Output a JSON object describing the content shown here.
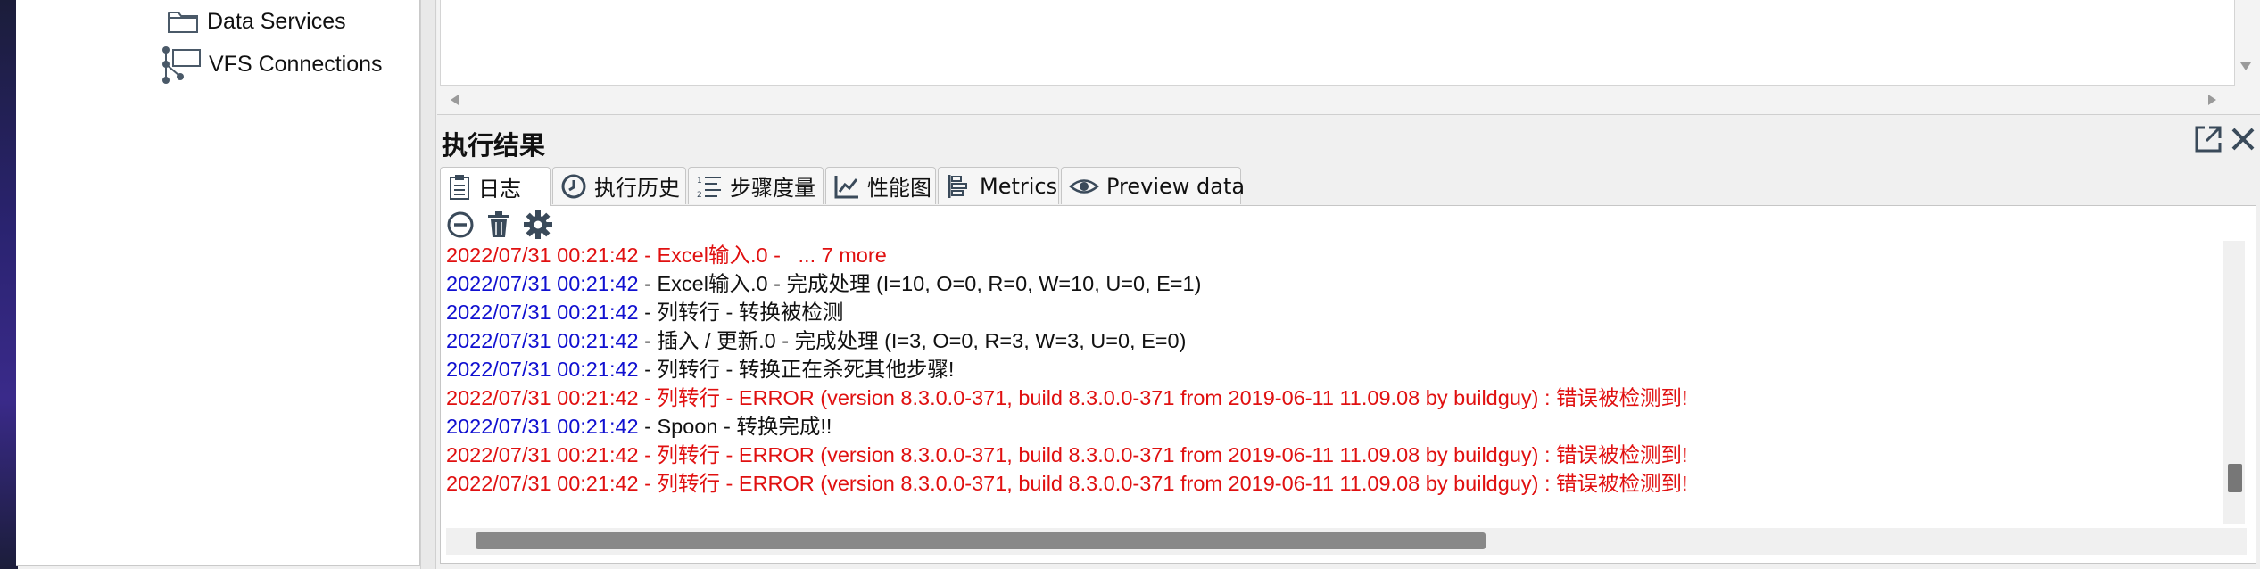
{
  "tree": {
    "items": [
      {
        "label": "Data Services",
        "icon": "folder-icon"
      },
      {
        "label": "VFS Connections",
        "icon": "network-icon"
      }
    ]
  },
  "results": {
    "title": "执行结果"
  },
  "tabs": [
    {
      "label": "日志",
      "icon": "log-icon",
      "active": true
    },
    {
      "label": "执行历史",
      "icon": "history-icon",
      "active": false
    },
    {
      "label": "步骤度量",
      "icon": "step-metrics-icon",
      "active": false
    },
    {
      "label": "性能图",
      "icon": "performance-chart-icon",
      "active": false
    },
    {
      "label": "Metrics",
      "icon": "metrics-icon",
      "active": false
    },
    {
      "label": "Preview data",
      "icon": "eye-icon",
      "active": false
    }
  ],
  "log": {
    "lines": [
      {
        "ts": "2022/07/31 00:21:42",
        "text": " - Excel输入.0 -   ... 7 more",
        "level": "error"
      },
      {
        "ts": "2022/07/31 00:21:42",
        "text": " - Excel输入.0 - 完成处理 (I=10, O=0, R=0, W=10, U=0, E=1)",
        "level": "normal"
      },
      {
        "ts": "2022/07/31 00:21:42",
        "text": " - 列转行 - 转换被检测",
        "level": "normal"
      },
      {
        "ts": "2022/07/31 00:21:42",
        "text": " - 插入 / 更新.0 - 完成处理 (I=3, O=0, R=3, W=3, U=0, E=0)",
        "level": "normal"
      },
      {
        "ts": "2022/07/31 00:21:42",
        "text": " - 列转行 - 转换正在杀死其他步骤!",
        "level": "normal"
      },
      {
        "ts": "2022/07/31 00:21:42",
        "text": " - 列转行 - ERROR (version 8.3.0.0-371, build 8.3.0.0-371 from 2019-06-11 11.09.08 by buildguy) : 错误被检测到!",
        "level": "error"
      },
      {
        "ts": "2022/07/31 00:21:42",
        "text": " - Spoon - 转换完成!!",
        "level": "normal"
      },
      {
        "ts": "2022/07/31 00:21:42",
        "text": " - 列转行 - ERROR (version 8.3.0.0-371, build 8.3.0.0-371 from 2019-06-11 11.09.08 by buildguy) : 错误被检测到!",
        "level": "error"
      },
      {
        "ts": "2022/07/31 00:21:42",
        "text": " - 列转行 - ERROR (version 8.3.0.0-371, build 8.3.0.0-371 from 2019-06-11 11.09.08 by buildguy) : 错误被检测到!",
        "level": "error"
      }
    ]
  },
  "colors": {
    "timestamp": "#1010d0",
    "error": "#e01010",
    "normal": "#111111",
    "icon": "#3a4a5a"
  }
}
